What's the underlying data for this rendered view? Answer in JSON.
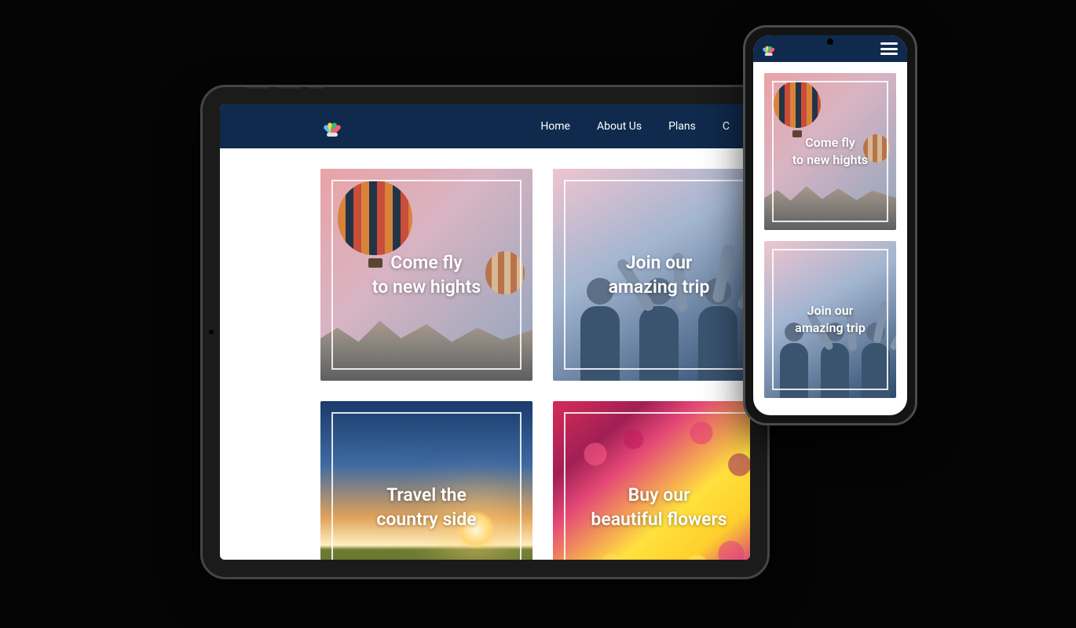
{
  "nav": {
    "items": [
      "Home",
      "About Us",
      "Plans",
      "C"
    ]
  },
  "cards": {
    "balloon": {
      "line1": "Come fly",
      "line2": "to new hights"
    },
    "trip": {
      "line1": "Join our",
      "line2": "amazing trip"
    },
    "sunset": {
      "line1": "Travel the",
      "line2": "country side"
    },
    "flowers": {
      "line1": "Buy our",
      "line2": "beautiful flowers"
    }
  }
}
